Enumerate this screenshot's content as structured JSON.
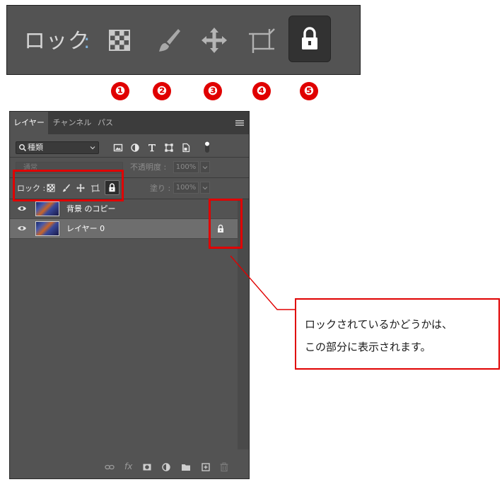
{
  "lock_bar": {
    "label": "ロック",
    "colon": ":",
    "icons": [
      "lock-transparent-pixels-icon",
      "lock-image-pixels-icon",
      "lock-position-icon",
      "lock-artboard-icon",
      "lock-all-icon"
    ],
    "selected": "lock-all-icon"
  },
  "markers": [
    "❶",
    "❷",
    "❸",
    "❹",
    "❺"
  ],
  "layers_panel": {
    "tabs": [
      {
        "label": "レイヤー",
        "active": true
      },
      {
        "label": "チャンネル",
        "active": false
      },
      {
        "label": "パス",
        "active": false
      }
    ],
    "filter": {
      "kind": "種類"
    },
    "filter_icons": [
      "pixel-filter-icon",
      "adjustment-filter-icon",
      "type-filter-icon",
      "shape-filter-icon",
      "smart-object-filter-icon",
      "filter-toggle-icon"
    ],
    "blend_mode": "通常",
    "opacity_label": "不透明度 :",
    "opacity_value": "100%",
    "lock_label": "ロック :",
    "fill_label": "塗り :",
    "fill_value": "100%",
    "layers": [
      {
        "name": "背景 のコピー",
        "selected": false,
        "locked": false
      },
      {
        "name": "レイヤー 0",
        "selected": true,
        "locked": true
      }
    ],
    "bottom_icons": [
      "link-layers-icon",
      "fx-icon",
      "layer-mask-icon",
      "adjustment-layer-icon",
      "folder-icon",
      "new-layer-icon",
      "trash-icon"
    ],
    "fx_label": "fx"
  },
  "callout": {
    "line1": "ロックされているかどうかは、",
    "line2": "この部分に表示されます。"
  },
  "colors": {
    "annotation_red": "#e00000",
    "panel_bg": "#535353",
    "selected_row": "#6e6e6e"
  }
}
